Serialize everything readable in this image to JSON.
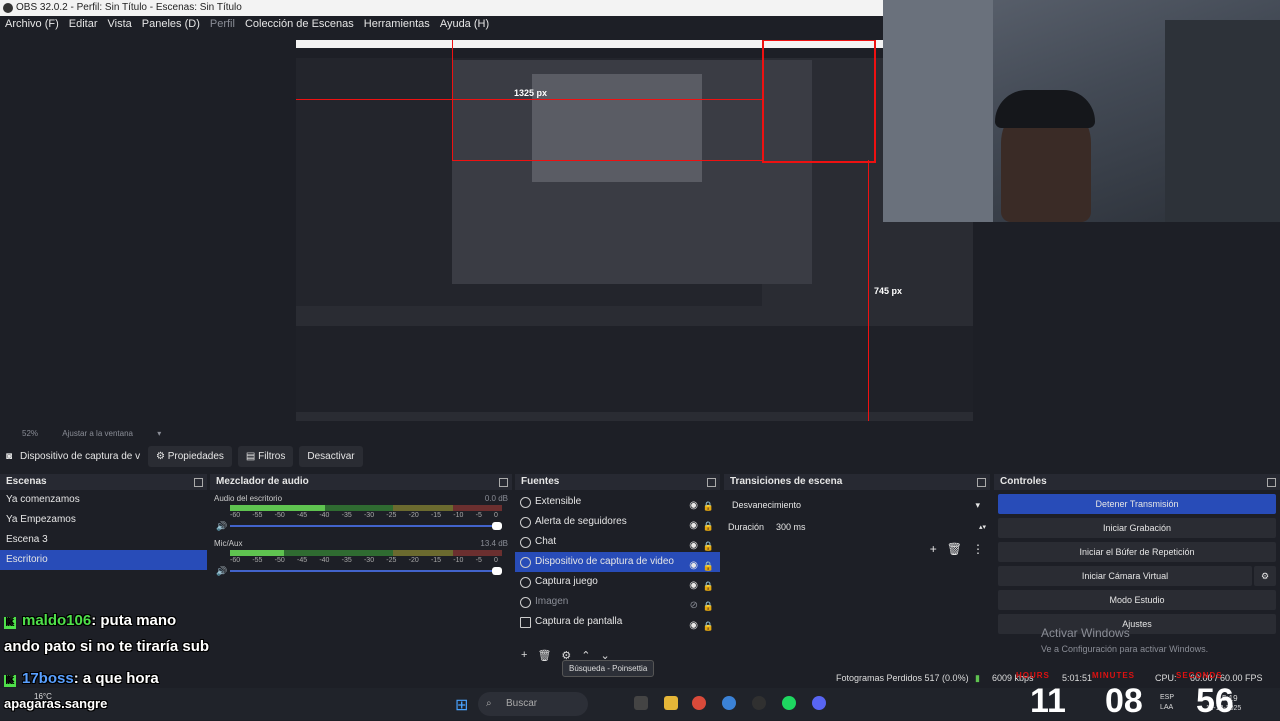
{
  "window": {
    "title": "OBS 32.0.2 - Perfil: Sin Título - Escenas: Sin Título"
  },
  "menu": [
    "Archivo (F)",
    "Editar",
    "Vista",
    "Paneles (D)",
    "Perfil",
    "Colección de Escenas",
    "Herramientas",
    "Ayuda (H)"
  ],
  "preview": {
    "label_1325": "1325 px",
    "label_745": "745 px"
  },
  "zoom": {
    "level": "52%",
    "fit": "Ajustar a la ventana"
  },
  "propsbar": {
    "source": "Dispositivo de captura de v",
    "properties": "Propiedades",
    "filters": "Filtros",
    "deactivate": "Desactivar"
  },
  "scenes": {
    "title": "Escenas",
    "items": [
      "Ya comenzamos",
      "Ya Empezamos",
      "Escena 3",
      "Escritorio"
    ],
    "selected_index": 3
  },
  "mixer": {
    "title": "Mezclador de audio",
    "channels": [
      {
        "name": "Audio del escritorio",
        "db": "0.0 dB"
      },
      {
        "name": "Mic/Aux",
        "db": "13.4 dB"
      }
    ],
    "scale": [
      "-60",
      "-55",
      "-50",
      "-45",
      "-40",
      "-35",
      "-30",
      "-25",
      "-20",
      "-15",
      "-10",
      "-5",
      "0"
    ]
  },
  "sources": {
    "title": "Fuentes",
    "items": [
      {
        "name": "Extensible",
        "state": "normal"
      },
      {
        "name": "Alerta de seguidores",
        "state": "normal"
      },
      {
        "name": "Chat",
        "state": "normal"
      },
      {
        "name": "Dispositivo de captura de video",
        "state": "selected"
      },
      {
        "name": "Captura juego",
        "state": "normal"
      },
      {
        "name": "Imagen",
        "state": "hidden"
      },
      {
        "name": "Captura de pantalla",
        "state": "normal"
      }
    ],
    "tooltip": "Búsqueda - Poinsettia"
  },
  "transitions": {
    "title": "Transiciones de escena",
    "selected": "Desvanecimiento",
    "duration_label": "Duración",
    "duration_value": "300 ms"
  },
  "controls": {
    "title": "Controles",
    "buttons": [
      {
        "label": "Detener Transmisión",
        "active": true
      },
      {
        "label": "Iniciar Grabación",
        "active": false
      },
      {
        "label": "Iniciar el Búfer de Repetición",
        "active": false
      },
      {
        "label": "Iniciar Cámara Virtual",
        "active": false
      },
      {
        "label": "Modo Estudio",
        "active": false
      },
      {
        "label": "Ajustes",
        "active": false
      }
    ]
  },
  "watermark": {
    "line1": "Activar Windows",
    "line2": "Ve a Configuración para activar Windows."
  },
  "status": {
    "dropped": "Fotogramas Perdidos 517 (0.0%)",
    "kbps": "6009 kbps",
    "time": "5:01:51",
    "cpu": "CPU:",
    "fps": "60.00 / 60.00 FPS"
  },
  "chat": [
    {
      "user": "maldo106",
      "text": ": puta mano",
      "line2": "ando pato si no te tiraría sub"
    },
    {
      "user": "17boss",
      "text": ": a que hora"
    }
  ],
  "chat_extra": "apagaras.sangre",
  "clock": {
    "hours": "11",
    "minutes": "08",
    "seconds": "56",
    "hours_label": "HOURS",
    "minutes_label": "MINUTES",
    "seconds_label": "SECONDS"
  },
  "taskbar": {
    "weather": "16°C",
    "search_placeholder": "Buscar",
    "lang": "ESP",
    "lang2": "LAA",
    "time": "5:19",
    "date": "11-12-2025"
  },
  "colors": {
    "accent": "#284cb8",
    "background": "#1d1f26",
    "chat_user": "#4fe04a",
    "clock_label": "#d11111"
  }
}
